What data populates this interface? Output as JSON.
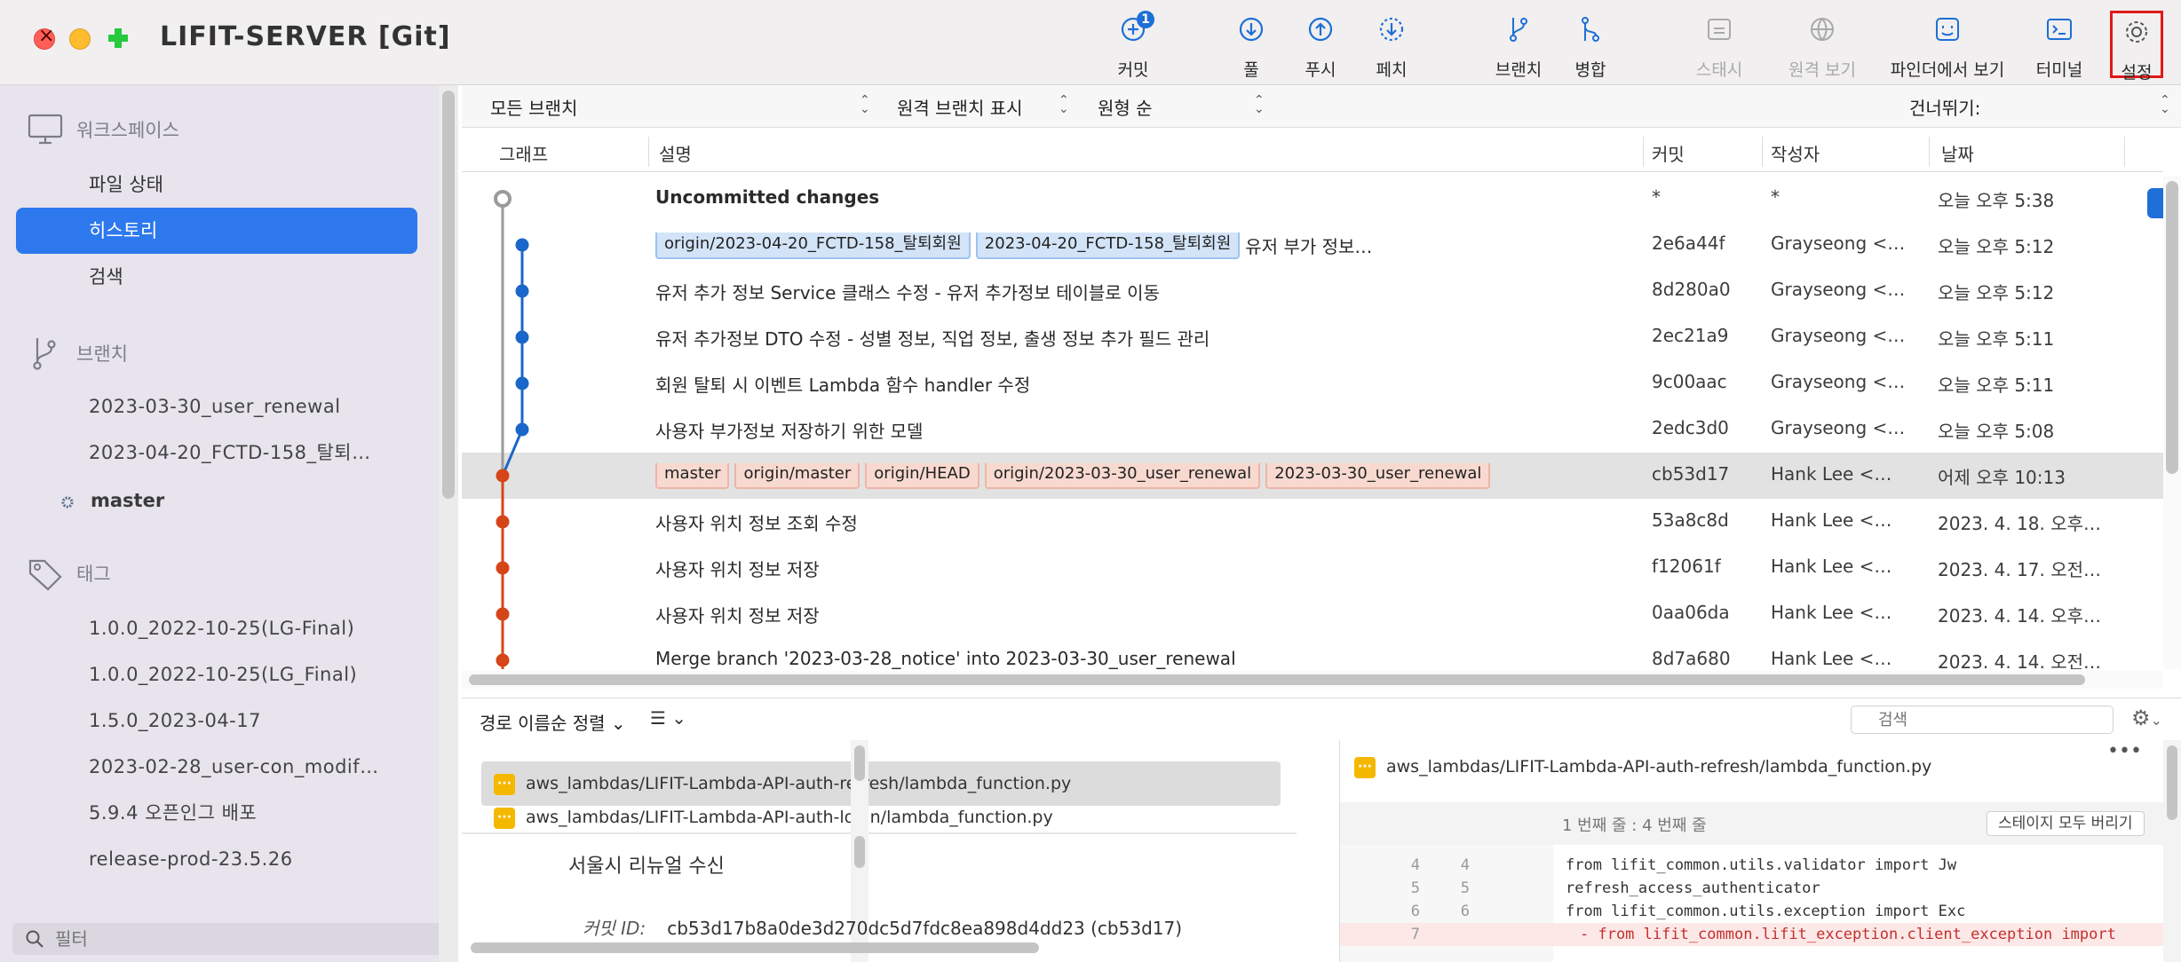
{
  "window": {
    "title": "LIFIT-SERVER [Git]"
  },
  "toolbar": {
    "commit": {
      "label": "커밋",
      "badge": "1"
    },
    "pull": {
      "label": "풀"
    },
    "push": {
      "label": "푸시"
    },
    "fetch": {
      "label": "페치"
    },
    "branch": {
      "label": "브랜치"
    },
    "merge": {
      "label": "병합"
    },
    "stash": {
      "label": "스태시"
    },
    "remote": {
      "label": "원격 보기"
    },
    "finder": {
      "label": "파인더에서 보기"
    },
    "terminal": {
      "label": "터미널"
    },
    "settings": {
      "label": "설정"
    }
  },
  "sidebar": {
    "workspace": {
      "title": "워크스페이스",
      "items": [
        "파일 상태",
        "히스토리",
        "검색"
      ]
    },
    "branches": {
      "title": "브랜치",
      "items": [
        "2023-03-30_user_renewal",
        "2023-04-20_FCTD-158_탈퇴…",
        "master"
      ]
    },
    "tags": {
      "title": "태그",
      "items": [
        "1.0.0_2022-10-25(LG-Final)",
        "1.0.0_2022-10-25(LG_Final)",
        "1.5.0_2023-04-17",
        "2023-02-28_user-con_modif…",
        "5.9.4 오픈인그 배포",
        "release-prod-23.5.26"
      ]
    },
    "filter_placeholder": "필터"
  },
  "filterbar": {
    "branches": "모든 브랜치",
    "remote": "원격 브랜치 표시",
    "order": "원형 순",
    "jump": "건너뛰기:"
  },
  "columns": {
    "graph": "그래프",
    "description": "설명",
    "commit": "커밋",
    "author": "작성자",
    "date": "날짜"
  },
  "history": [
    {
      "tags": [],
      "desc": "Uncommitted changes",
      "commit": "*",
      "author": "*",
      "date": "오늘 오후 5:38",
      "bold": true
    },
    {
      "tags": [
        {
          "text": "origin/2023-04-20_FCTD-158_탈퇴회원",
          "color": "blue"
        },
        {
          "text": "2023-04-20_FCTD-158_탈퇴회원",
          "color": "blue"
        }
      ],
      "desc": "유저 부가 정보…",
      "commit": "2e6a44f",
      "author": "Grayseong <…",
      "date": "오늘 오후 5:12"
    },
    {
      "tags": [],
      "desc": "유저 추가 정보 Service 클래스 수정 - 유저 추가정보 테이블로 이동",
      "commit": "8d280a0",
      "author": "Grayseong <…",
      "date": "오늘 오후 5:12"
    },
    {
      "tags": [],
      "desc": "유저 추가정보 DTO 수정 - 성별 정보, 직업 정보, 출생 정보 추가 필드 관리",
      "commit": "2ec21a9",
      "author": "Grayseong <…",
      "date": "오늘 오후 5:11"
    },
    {
      "tags": [],
      "desc": "회원 탈퇴 시 이벤트 Lambda 함수 handler 수정",
      "commit": "9c00aac",
      "author": "Grayseong <…",
      "date": "오늘 오후 5:11"
    },
    {
      "tags": [],
      "desc": "사용자 부가정보 저장하기 위한 모델",
      "commit": "2edc3d0",
      "author": "Grayseong <…",
      "date": "오늘 오후 5:08"
    },
    {
      "tags": [
        {
          "text": "master",
          "color": "orange"
        },
        {
          "text": "origin/master",
          "color": "orange"
        },
        {
          "text": "origin/HEAD",
          "color": "orange"
        },
        {
          "text": "origin/2023-03-30_user_renewal",
          "color": "orange"
        },
        {
          "text": "2023-03-30_user_renewal",
          "color": "orange"
        }
      ],
      "desc": "",
      "commit": "cb53d17",
      "author": "Hank Lee <…",
      "date": "어제 오후 10:13",
      "selected": true
    },
    {
      "tags": [],
      "desc": "사용자 위치 정보 조회 수정",
      "commit": "53a8c8d",
      "author": "Hank Lee <…",
      "date": "2023. 4. 18. 오후…"
    },
    {
      "tags": [],
      "desc": "사용자 위치 정보 저장",
      "commit": "f12061f",
      "author": "Hank Lee <…",
      "date": "2023. 4. 17. 오전…"
    },
    {
      "tags": [],
      "desc": "사용자 위치 정보 저장",
      "commit": "0aa06da",
      "author": "Hank Lee <…",
      "date": "2023. 4. 14. 오후…"
    },
    {
      "tags": [],
      "desc": "Merge branch '2023-03-28_notice' into 2023-03-30_user_renewal",
      "commit": "8d7a680",
      "author": "Hank Lee <…",
      "date": "2023. 4. 14. 오전…"
    }
  ],
  "bottom": {
    "sort_label": "경로 이름순 정렬",
    "search_placeholder": "검색",
    "files": [
      "aws_lambdas/LIFIT-Lambda-API-auth-refresh/lambda_function.py",
      "aws_lambdas/LIFIT-Lambda-API-auth-login/lambda_function.py"
    ],
    "commit_message": "서울시 리뉴얼 수신",
    "commit_id_label": "커밋 ID:",
    "commit_id": "cb53d17b8a0de3d270dc5d7fdc8ea898d4dd23 (cb53d17)"
  },
  "diff": {
    "file": "aws_lambdas/LIFIT-Lambda-API-auth-refresh/lambda_function.py",
    "hunk": "1 번째 줄 : 4 번째 줄",
    "hunk_button": "스테이지 모두 버리기",
    "lines": [
      {
        "n1": "4",
        "n2": "4",
        "code": "from lifit_common.utils.validator import Jw",
        "type": "ctx"
      },
      {
        "n1": "5",
        "n2": "5",
        "code": "    refresh_access_authenticator",
        "type": "ctx"
      },
      {
        "n1": "6",
        "n2": "6",
        "code": "from lifit_common.utils.exception import Exc",
        "type": "ctx"
      },
      {
        "n1": "7",
        "n2": "",
        "code": "- from lifit_common.lifit_exception.client_exception import",
        "type": "del"
      }
    ]
  },
  "colors": {
    "accent": "#2e78ee",
    "branch_blue": "#1b66c9",
    "branch_red": "#d64518",
    "highlight_red": "#e11919"
  }
}
